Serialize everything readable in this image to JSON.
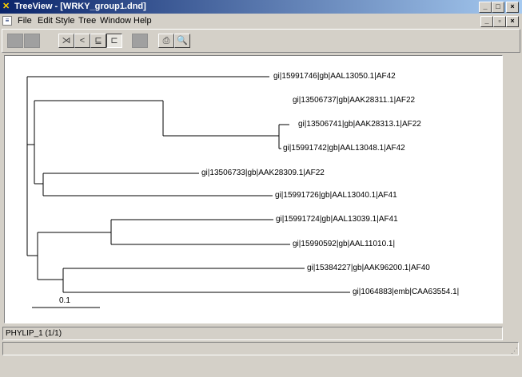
{
  "window": {
    "title": "TreeView - [WRKY_group1.dnd]",
    "controls": [
      "_",
      "□",
      "×"
    ],
    "mdi_controls": [
      "_",
      "▫",
      "×"
    ]
  },
  "menu": [
    {
      "label": "File"
    },
    {
      "label": "Edit"
    },
    {
      "label": "Style"
    },
    {
      "label": "Tree"
    },
    {
      "label": "Window"
    },
    {
      "label": "Help"
    }
  ],
  "toolbar": {
    "buttons": [
      "cut-disabled",
      "copy-disabled",
      "slanted-tree",
      "rectangular-tree",
      "phylogram",
      "tree-view",
      "unavailable",
      "print",
      "print-preview"
    ]
  },
  "tree": {
    "leaves": [
      "gi|15991746|gb|AAL13050.1|AF42",
      "gi|13506737|gb|AAK28311.1|AF22",
      "gi|13506741|gb|AAK28313.1|AF22",
      "gi|15991742|gb|AAL13048.1|AF42",
      "gi|13506733|gb|AAK28309.1|AF22",
      "gi|15991726|gb|AAL13040.1|AF41",
      "gi|15991724|gb|AAL13039.1|AF41",
      "gi|15990592|gb|AAL11010.1|",
      "gi|15384227|gb|AAK96200.1|AF40",
      "gi|1064883|emb|CAA63554.1|"
    ],
    "scale_label": "0.1"
  },
  "status": {
    "text": "PHYLIP_1  (1/1)"
  }
}
